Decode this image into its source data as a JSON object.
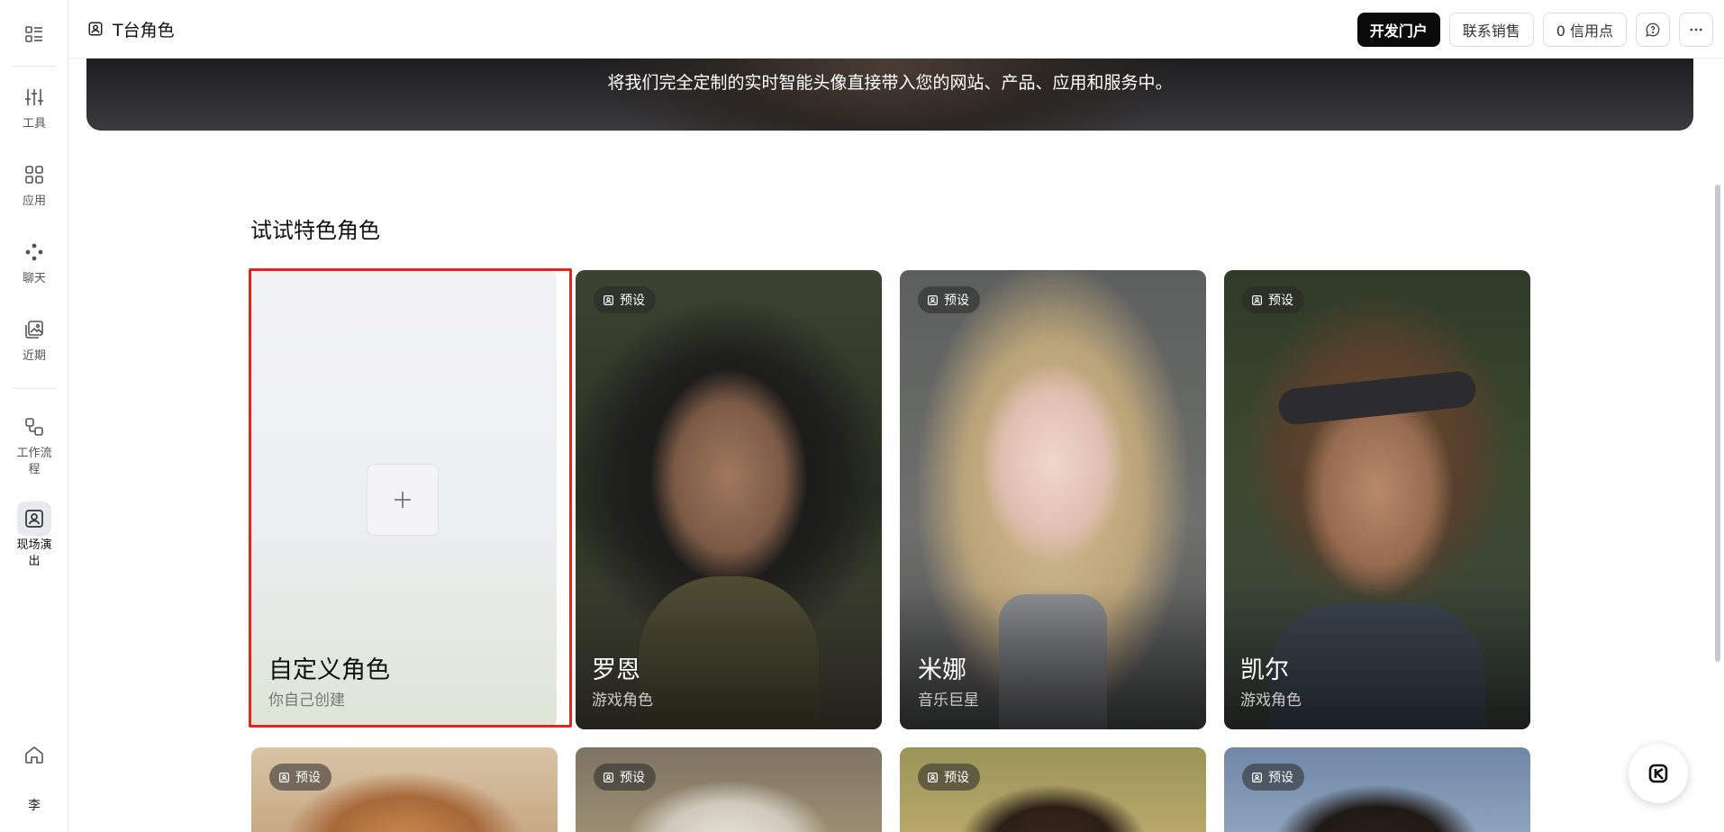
{
  "header": {
    "title": "T台角色",
    "buttons": {
      "dev_portal": "开发门户",
      "contact_sales": "联系销售",
      "credits": "0 信用点"
    }
  },
  "sidebar": {
    "items": [
      {
        "label": "工具",
        "icon": "tools-sliders-icon"
      },
      {
        "label": "应用",
        "icon": "apps-grid-icon"
      },
      {
        "label": "聊天",
        "icon": "chat-dots-icon"
      },
      {
        "label": "近期",
        "icon": "recent-image-icon"
      },
      {
        "label": "工作流程",
        "icon": "workflow-icon"
      },
      {
        "label": "现场演出",
        "icon": "live-performance-icon",
        "active": true
      }
    ],
    "avatar_char": "李"
  },
  "hero": {
    "text": "将我们完全定制的实时智能头像直接带入您的网站、产品、应用和服务中。"
  },
  "section": {
    "title": "试试特色角色"
  },
  "cards": [
    {
      "name": "自定义角色",
      "subtitle": "你自己创建",
      "type": "custom"
    },
    {
      "name": "罗恩",
      "subtitle": "游戏角色",
      "badge": "预设"
    },
    {
      "name": "米娜",
      "subtitle": "音乐巨星",
      "badge": "预设"
    },
    {
      "name": "凯尔",
      "subtitle": "游戏角色",
      "badge": "预设"
    }
  ],
  "cards_row2": [
    {
      "badge": "预设"
    },
    {
      "badge": "预设"
    },
    {
      "badge": "预设"
    },
    {
      "badge": "预设"
    }
  ],
  "colors": {
    "accent": "#0b0b0b",
    "selection": "#e3261c"
  }
}
